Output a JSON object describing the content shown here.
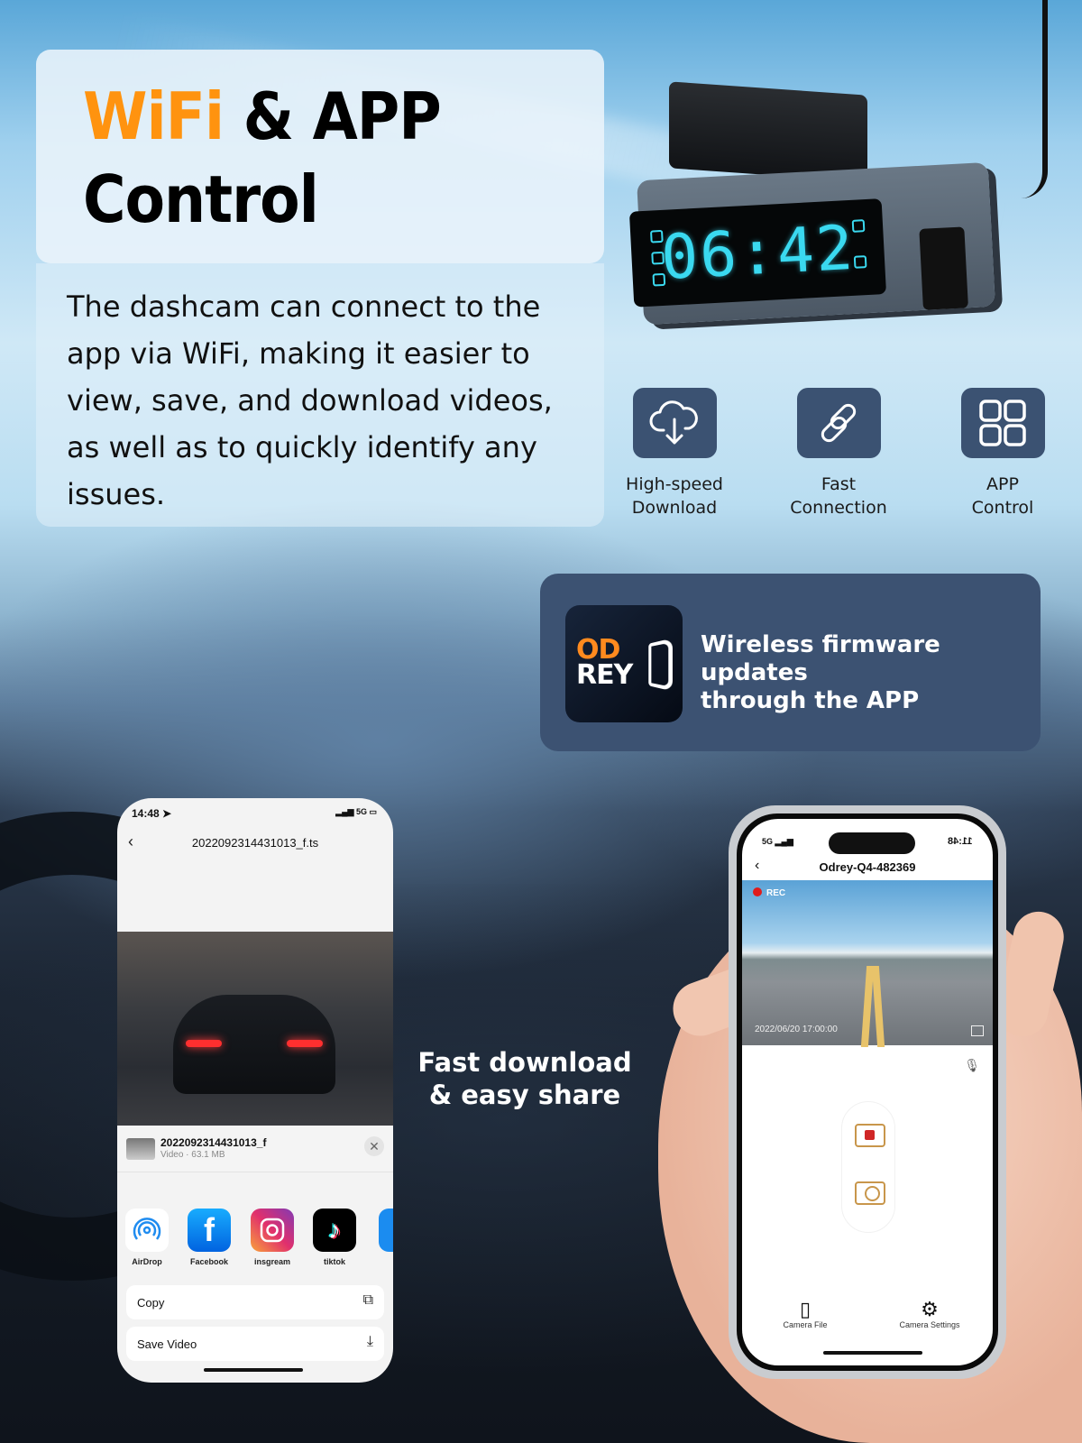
{
  "header": {
    "title_accent": "WiFi",
    "title_rest": " & APP",
    "title_line2": "Control",
    "description": "The dashcam can connect to the app via WiFi, making it easier to view, save, and download videos, as well as to quickly identify any issues."
  },
  "device": {
    "clock": "06:42"
  },
  "features": [
    {
      "icon": "cloud-download-icon",
      "label_line1": "High-speed",
      "label_line2": "Download"
    },
    {
      "icon": "link-icon",
      "label_line1": "Fast",
      "label_line2": "Connection"
    },
    {
      "icon": "grid-icon",
      "label_line1": "APP",
      "label_line2": "Control"
    }
  ],
  "firmware": {
    "logo_top": "OD",
    "logo_bottom": "REY",
    "text_line1": "Wireless firmware updates",
    "text_line2": "through the APP"
  },
  "mid_caption": {
    "line1": "Fast download",
    "line2": "& easy share"
  },
  "left_phone": {
    "time": "14:48",
    "network": "5G",
    "title": "2022092314431013_f.ts",
    "share_file_name": "2022092314431013_f",
    "share_file_meta": "Video · 63.1 MB",
    "apps": [
      {
        "name": "AirDrop",
        "color": "#ffffff"
      },
      {
        "name": "Facebook",
        "color": "#1877f2"
      },
      {
        "name": "insgream",
        "color": "#c13584"
      },
      {
        "name": "tiktok",
        "color": "#000000"
      }
    ],
    "actions": [
      {
        "label": "Copy",
        "icon": "copy-icon"
      },
      {
        "label": "Save Video",
        "icon": "save-icon"
      }
    ]
  },
  "right_phone": {
    "status_left": "5G",
    "status_time": "11:48",
    "title": "Odrey-Q4-482369",
    "rec_label": "REC",
    "timestamp": "2022/06/20  17:00:00",
    "tabs": [
      {
        "label": "Camera File",
        "icon": "sd-card-icon"
      },
      {
        "label": "Camera Settings",
        "icon": "gear-icon"
      }
    ]
  },
  "colors": {
    "accent_orange": "#ff930f",
    "panel_blue": "#3c5272",
    "lcd_cyan": "#3ad9f0",
    "rec_red": "#e01b1b"
  }
}
